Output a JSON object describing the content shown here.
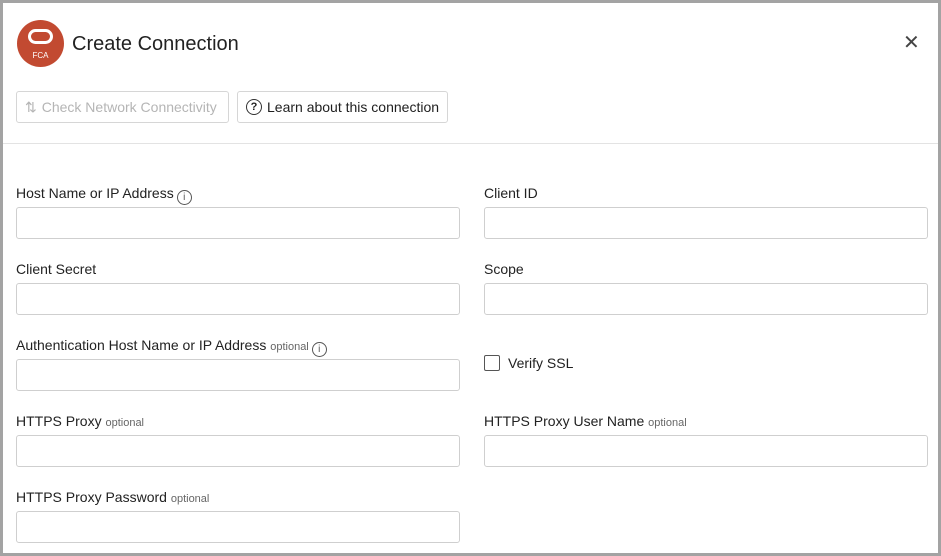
{
  "header": {
    "logo_text": "FCA",
    "title": "Create Connection"
  },
  "toolbar": {
    "check_label": "Check Network Connectivity",
    "learn_label": "Learn about this connection"
  },
  "fields": {
    "host": {
      "label": "Host Name or IP Address",
      "value": ""
    },
    "client_id": {
      "label": "Client ID",
      "value": ""
    },
    "client_secret": {
      "label": "Client Secret",
      "value": ""
    },
    "scope": {
      "label": "Scope",
      "value": ""
    },
    "auth_host": {
      "label": "Authentication Host Name or IP Address",
      "optional": "optional",
      "value": ""
    },
    "verify_ssl": {
      "label": "Verify SSL",
      "checked": false
    },
    "proxy": {
      "label": "HTTPS Proxy",
      "optional": "optional",
      "value": ""
    },
    "proxy_user": {
      "label": "HTTPS Proxy User Name",
      "optional": "optional",
      "value": ""
    },
    "proxy_pass": {
      "label": "HTTPS Proxy Password",
      "optional": "optional",
      "value": ""
    }
  }
}
